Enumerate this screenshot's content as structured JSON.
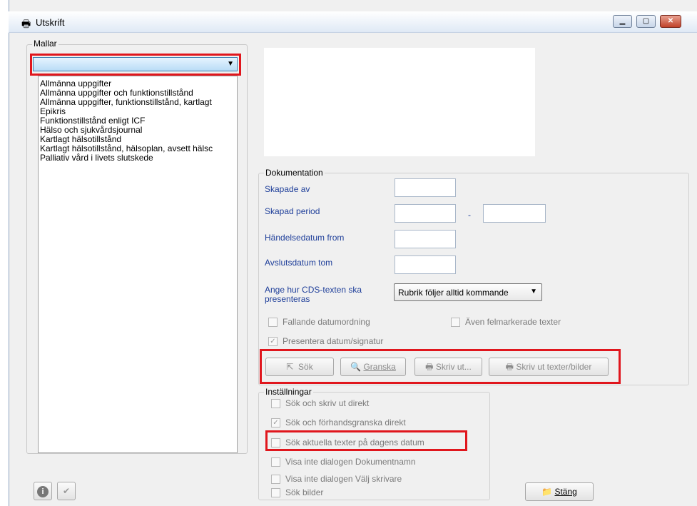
{
  "window": {
    "title": "Utskrift",
    "minimize": "▁",
    "maximize": "▢",
    "close": "✕"
  },
  "mallar": {
    "legend": "Mallar",
    "selected": "",
    "items": [
      "Allmänna uppgifter",
      "Allmänna uppgifter och funktionstillstånd",
      "Allmänna uppgifter, funktionstillstånd, kartlagt",
      "Epikris",
      "Funktionstillstånd enligt ICF",
      "Hälso och sjukvårdsjournal",
      "Kartlagt hälsotillstånd",
      "Kartlagt hälsotillstånd, hälsoplan, avsett hälsc",
      "Palliativ vård i livets slutskede"
    ]
  },
  "dokumentation": {
    "legend": "Dokumentation",
    "skapade_av": "Skapade av",
    "skapad_period": "Skapad period",
    "period_sep": "-",
    "handelsedatum": "Händelsedatum from",
    "avslutsdatum": "Avslutsdatum tom",
    "cds_label": "Ange hur CDS-texten ska presenteras",
    "cds_value": "Rubrik följer alltid kommande",
    "fallande": "Fallande datumordning",
    "aven": "Även felmarkerade texter",
    "presentera": "Presentera datum/signatur"
  },
  "buttons": {
    "sok": "Sök",
    "granska": "Granska",
    "skriv_ut": "Skriv ut...",
    "skriv_ut_texter": "Skriv ut texter/bilder",
    "stang": "Stäng"
  },
  "installningar": {
    "legend": "Inställningar",
    "items": [
      {
        "label": "Sök och skriv ut direkt",
        "checked": false
      },
      {
        "label": "Sök och förhandsgranska direkt",
        "checked": true
      },
      {
        "label": "Sök aktuella texter på dagens datum",
        "checked": false
      },
      {
        "label": "Visa inte dialogen Dokumentnamn",
        "checked": false
      },
      {
        "label": "Visa inte dialogen Välj skrivare",
        "checked": false
      },
      {
        "label": "Sök bilder",
        "checked": false
      }
    ]
  },
  "colors": {
    "highlight": "#e0161d",
    "label_blue": "#1f3f9a",
    "combo_blue": "#d8ecfb"
  }
}
